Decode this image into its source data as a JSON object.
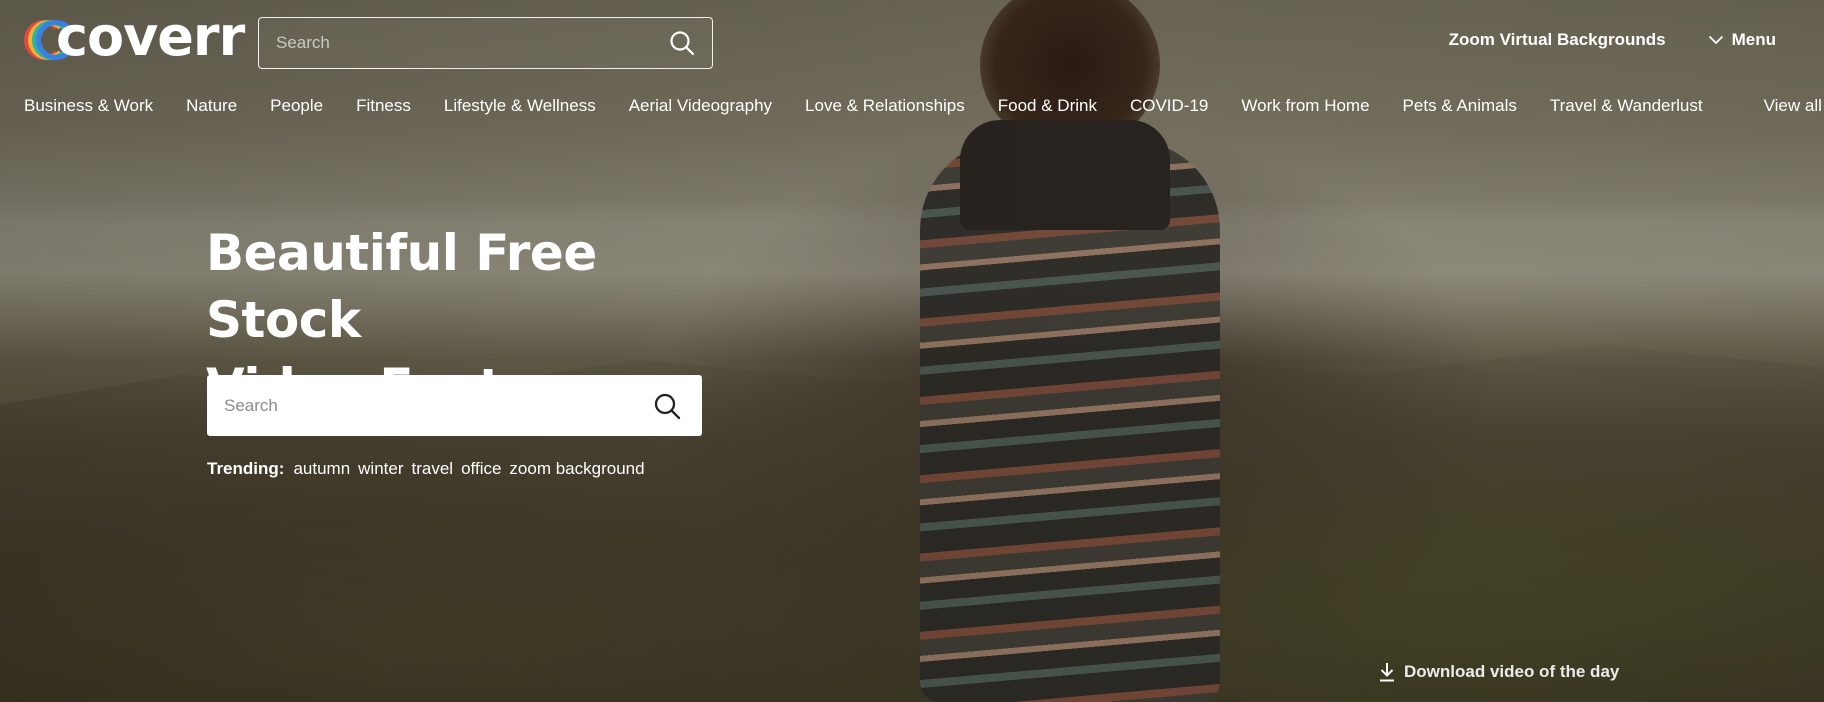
{
  "header": {
    "logo_text": "coverr",
    "search": {
      "placeholder": "Search",
      "value": ""
    },
    "zoom_link": "Zoom Virtual Backgrounds",
    "menu_label": "Menu"
  },
  "categories": {
    "items": [
      "Business & Work",
      "Nature",
      "People",
      "Fitness",
      "Lifestyle & Wellness",
      "Aerial Videography",
      "Love & Relationships",
      "Food & Drink",
      "COVID-19",
      "Work from Home",
      "Pets & Animals",
      "Travel & Wanderlust"
    ],
    "view_all": "View all"
  },
  "hero": {
    "title_line1": "Beautiful Free Stock",
    "title_line2": "Video Footage",
    "search": {
      "placeholder": "Search",
      "value": ""
    },
    "trending_label": "Trending:",
    "trending_tags": [
      "autumn",
      "winter",
      "travel",
      "office",
      "zoom background"
    ],
    "download_label": "Download video of the day"
  },
  "colors": {
    "logo_rings": [
      "#e7483a",
      "#f2b233",
      "#2bb3a5",
      "#3d7fe0"
    ],
    "text": "#ffffff",
    "search_bg": "#ffffff"
  },
  "icons": {
    "search": "search-icon",
    "chevron": "chevron-down-icon",
    "download": "download-icon"
  }
}
